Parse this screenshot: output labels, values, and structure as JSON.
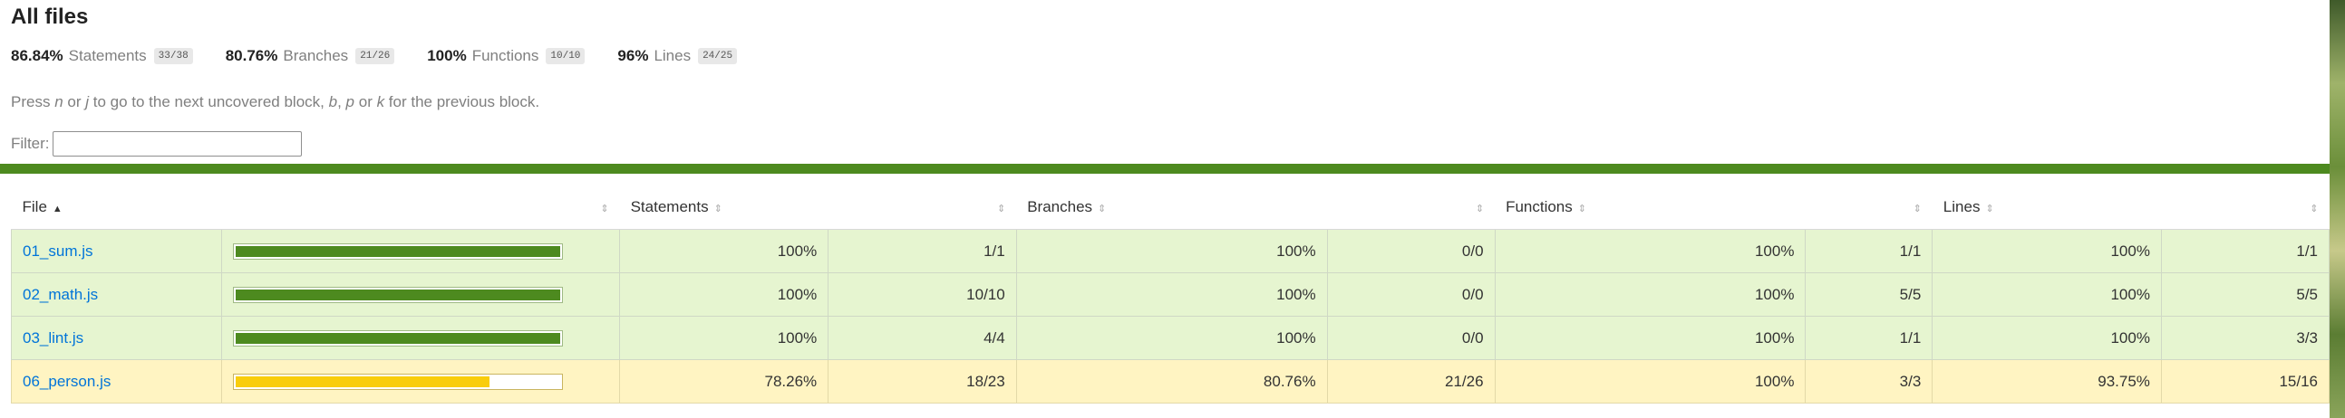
{
  "header": {
    "title": "All files"
  },
  "summary": [
    {
      "pct": "86.84%",
      "label": "Statements",
      "fraction": "33/38"
    },
    {
      "pct": "80.76%",
      "label": "Branches",
      "fraction": "21/26"
    },
    {
      "pct": "100%",
      "label": "Functions",
      "fraction": "10/10"
    },
    {
      "pct": "96%",
      "label": "Lines",
      "fraction": "24/25"
    }
  ],
  "hint": {
    "part1": "Press ",
    "k1": "n",
    "part2": " or ",
    "k2": "j",
    "part3": " to go to the next uncovered block, ",
    "k3": "b",
    "part4": ", ",
    "k4": "p",
    "part5": " or ",
    "k5": "k",
    "part6": " for the previous block."
  },
  "filter": {
    "label": "Filter:",
    "value": ""
  },
  "table": {
    "headers": {
      "file": "File",
      "statements": "Statements",
      "branches": "Branches",
      "functions": "Functions",
      "lines": "Lines"
    },
    "sort_asc_icon": "▲",
    "sort_icon": "⇕",
    "rows": [
      {
        "file": "01_sum.js",
        "status": "high",
        "coverage": 1.0,
        "statements_pct": "100%",
        "statements_frac": "1/1",
        "branches_pct": "100%",
        "branches_frac": "0/0",
        "functions_pct": "100%",
        "functions_frac": "1/1",
        "lines_pct": "100%",
        "lines_frac": "1/1"
      },
      {
        "file": "02_math.js",
        "status": "high",
        "coverage": 1.0,
        "statements_pct": "100%",
        "statements_frac": "10/10",
        "branches_pct": "100%",
        "branches_frac": "0/0",
        "functions_pct": "100%",
        "functions_frac": "5/5",
        "lines_pct": "100%",
        "lines_frac": "5/5"
      },
      {
        "file": "03_lint.js",
        "status": "high",
        "coverage": 1.0,
        "statements_pct": "100%",
        "statements_frac": "4/4",
        "branches_pct": "100%",
        "branches_frac": "0/0",
        "functions_pct": "100%",
        "functions_frac": "1/1",
        "lines_pct": "100%",
        "lines_frac": "3/3"
      },
      {
        "file": "06_person.js",
        "status": "medium",
        "coverage": 0.7826,
        "statements_pct": "78.26%",
        "statements_frac": "18/23",
        "branches_pct": "80.76%",
        "branches_frac": "21/26",
        "functions_pct": "100%",
        "functions_frac": "3/3",
        "lines_pct": "93.75%",
        "lines_frac": "15/16"
      }
    ]
  },
  "colors": {
    "high": "#e6f5d0",
    "medium": "#fff4c2",
    "bar_high": "#4d8a1f",
    "bar_medium": "#f9cd0b",
    "status_line": "#4d8a1f"
  }
}
